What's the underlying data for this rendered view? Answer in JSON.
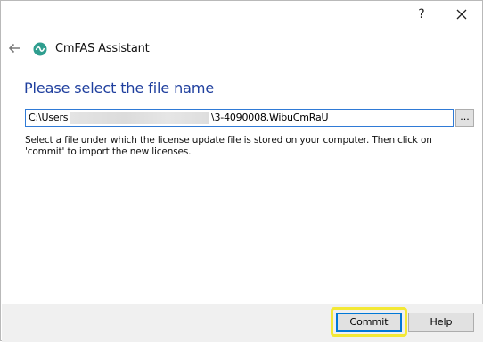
{
  "titlebar": {
    "help_glyph": "?",
    "close_icon": "close-icon"
  },
  "header": {
    "app_title": "CmFAS Assistant",
    "back_icon": "back-arrow-icon",
    "logo_icon": "cmfas-logo-icon"
  },
  "main": {
    "heading": "Please select the file name",
    "file_path": {
      "prefix": "C:\\Users",
      "suffix": "\\3-4090008.WibuCmRaU"
    },
    "browse_label": "...",
    "description": "Select a file under which the license update file is stored on your computer. Then click on 'commit' to import the new licenses."
  },
  "footer": {
    "commit_label": "Commit",
    "help_label": "Help"
  },
  "colors": {
    "heading": "#1f3f9e",
    "focus_border": "#0078d7",
    "highlight": "#f3e835",
    "logo": "#2f9e8f"
  }
}
